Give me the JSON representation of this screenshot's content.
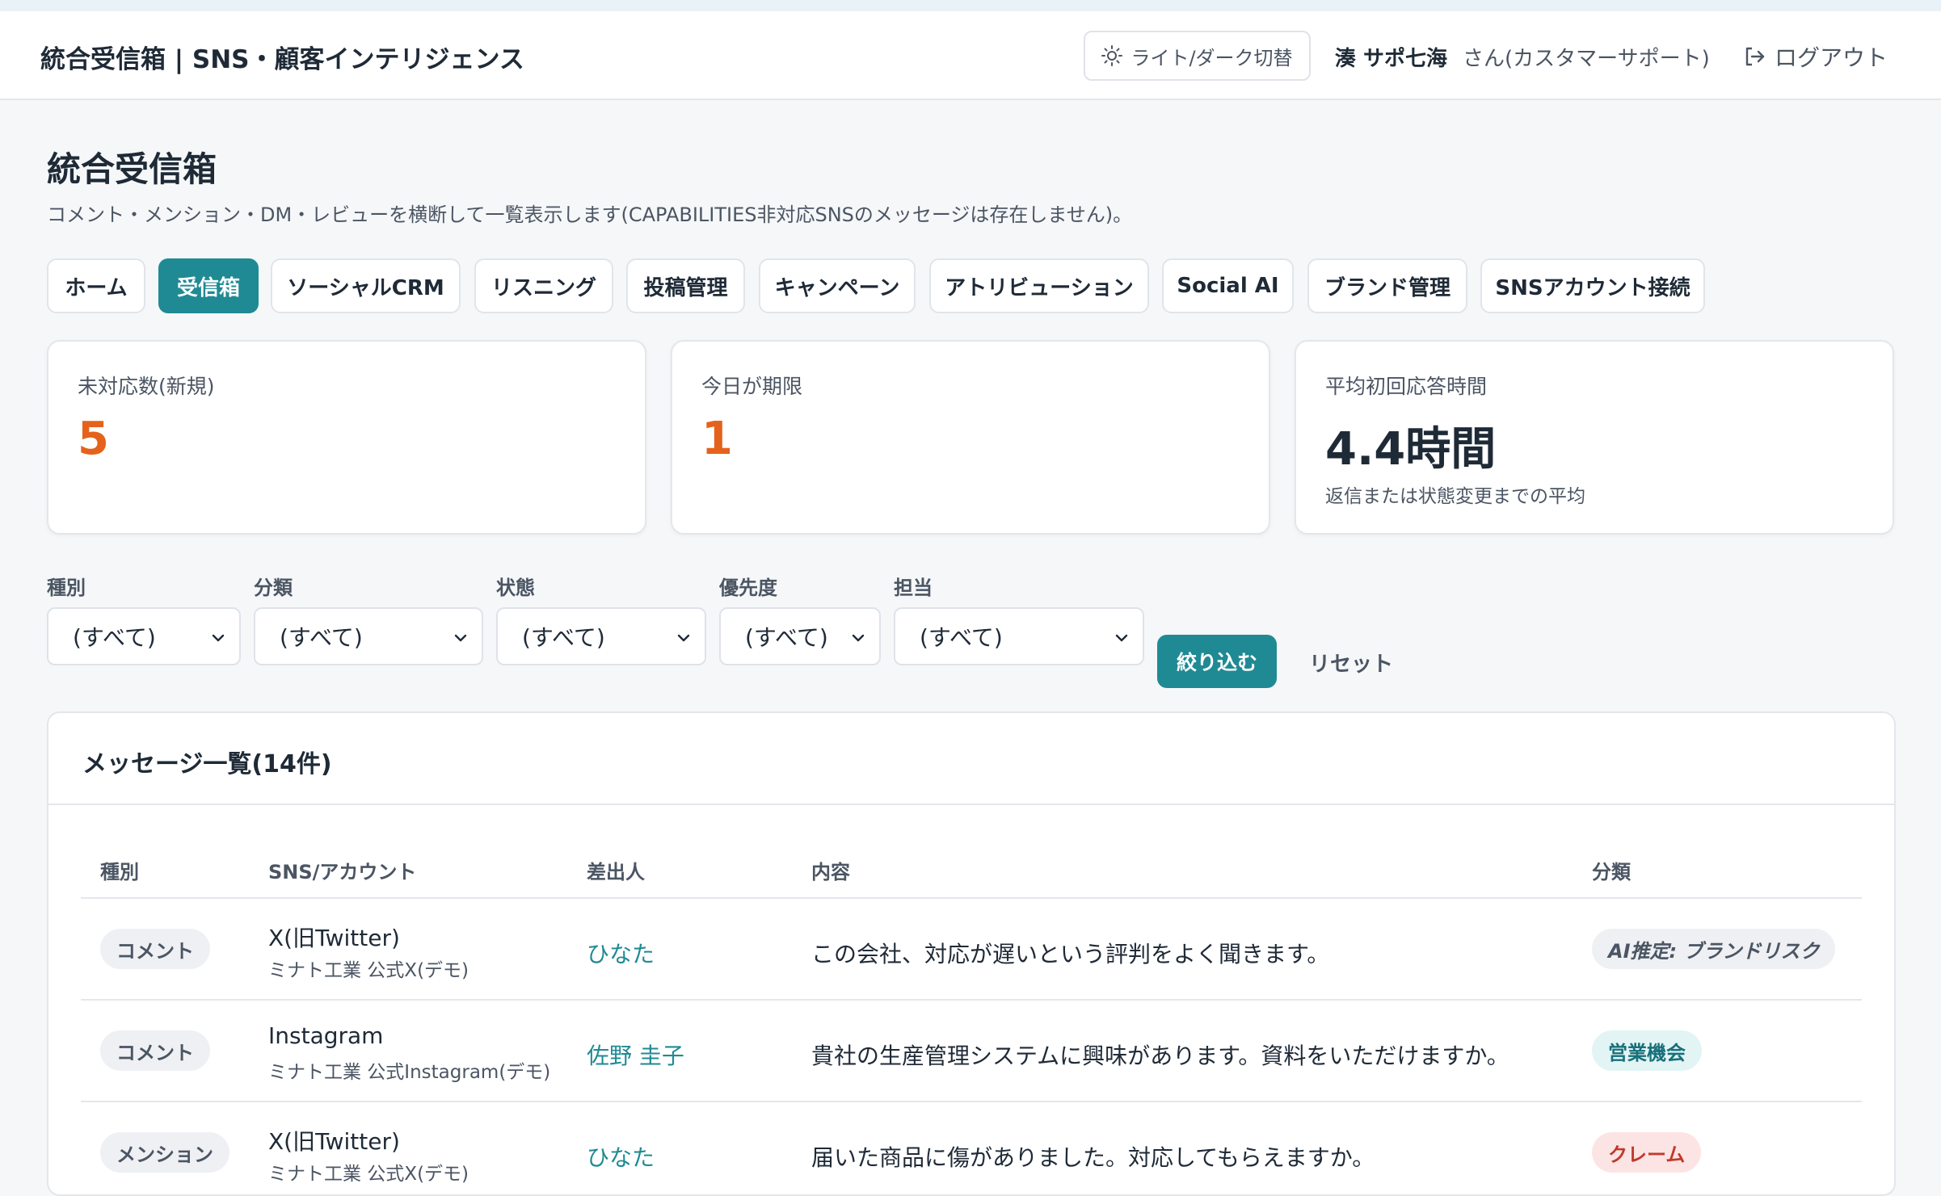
{
  "header": {
    "app_title": "統合受信箱 | SNS・顧客インテリジェンス",
    "theme_toggle_label": "ライト/ダーク切替",
    "user_name": "湊 サポ七海",
    "user_role": "さん(カスタマーサポート)",
    "logout_label": "ログアウト"
  },
  "page": {
    "title": "統合受信箱",
    "description": "コメント・メンション・DM・レビューを横断して一覧表示します(CAPABILITIES非対応SNSのメッセージは存在しません)。"
  },
  "tabs": [
    {
      "label": "ホーム"
    },
    {
      "label": "受信箱",
      "active": true
    },
    {
      "label": "ソーシャルCRM"
    },
    {
      "label": "リスニング"
    },
    {
      "label": "投稿管理"
    },
    {
      "label": "キャンペーン"
    },
    {
      "label": "アトリビューション"
    },
    {
      "label": "Social AI"
    },
    {
      "label": "ブランド管理"
    },
    {
      "label": "SNSアカウント接続"
    }
  ],
  "stats": [
    {
      "label": "未対応数(新規)",
      "value": "5"
    },
    {
      "label": "今日が期限",
      "value": "1"
    },
    {
      "label": "平均初回応答時間",
      "value": "4.4時間",
      "sub": "返信または状態変更までの平均"
    }
  ],
  "filters": [
    {
      "label": "種別",
      "value": "(すべて)"
    },
    {
      "label": "分類",
      "value": "(すべて)"
    },
    {
      "label": "状態",
      "value": "(すべて)"
    },
    {
      "label": "優先度",
      "value": "(すべて)"
    },
    {
      "label": "担当",
      "value": "(すべて)"
    }
  ],
  "filter_button": "絞り込む",
  "reset_button": "リセット",
  "list": {
    "title": "メッセージ一覧(14件)",
    "columns": [
      "種別",
      "SNS/アカウント",
      "差出人",
      "内容",
      "分類"
    ],
    "rows": [
      {
        "type": "コメント",
        "sns": "X(旧Twitter)",
        "account": "ミナト工業 公式X(デモ)",
        "sender": "ひなた",
        "content": "この会社、対応が遅いという評判をよく聞きます。",
        "category": "AI推定: ブランドリスク"
      },
      {
        "type": "コメント",
        "sns": "Instagram",
        "account": "ミナト工業 公式Instagram(デモ)",
        "sender": "佐野 圭子",
        "content": "貴社の生産管理システムに興味があります。資料をいただけますか。",
        "category": "営業機会"
      },
      {
        "type": "メンション",
        "sns": "X(旧Twitter)",
        "account": "ミナト工業 公式X(デモ)",
        "sender": "ひなた",
        "content": "届いた商品に傷がありました。対応してもらえますか。",
        "category": "クレーム"
      }
    ]
  },
  "colors": {
    "accent": "#1f8a94",
    "warning": "#e5621c",
    "risk_badge_bg": "#eef0f3",
    "sales_badge_bg": "#e3f4f4",
    "claim_badge_bg": "#fde4e4"
  }
}
